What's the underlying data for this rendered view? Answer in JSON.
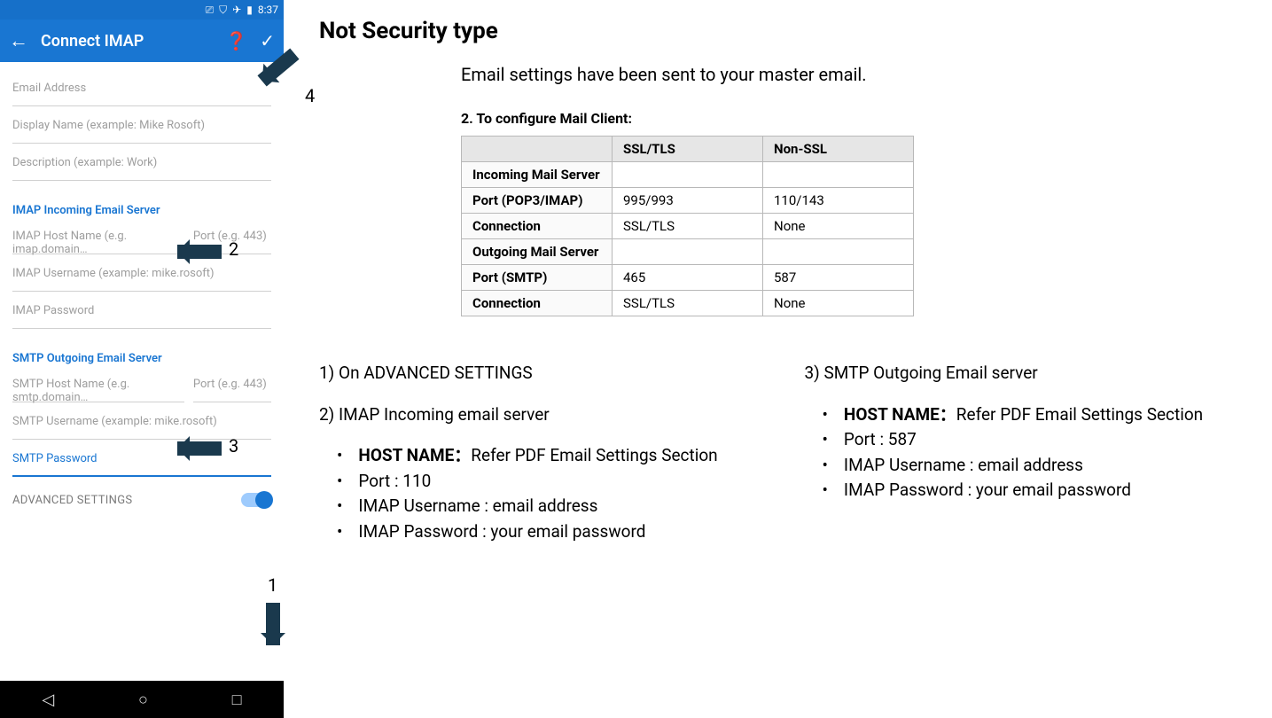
{
  "phone": {
    "status_time": "8:37",
    "icons": {
      "cast": "cast-icon",
      "wifi": "wifi-icon",
      "airplane": "airplane-icon",
      "battery": "battery-icon"
    },
    "appbar": {
      "title": "Connect IMAP"
    },
    "fields": {
      "email_ph": "Email Address",
      "display_ph": "Display Name (example: Mike Rosoft)",
      "desc_ph": "Description (example: Work)",
      "imap_section": "IMAP Incoming Email Server",
      "imap_host_ph": "IMAP Host Name (e.g. imap.domain…",
      "imap_port_ph": "Port (e.g. 443)",
      "imap_user_ph": "IMAP Username (example: mike.rosoft)",
      "imap_pw_ph": "IMAP Password",
      "smtp_section": "SMTP Outgoing Email Server",
      "smtp_host_ph": "SMTP Host Name (e.g. smtp.domain…",
      "smtp_port_ph": "Port (e.g. 443)",
      "smtp_user_ph": "SMTP Username (example: mike.rosoft)",
      "smtp_pw_ph": "SMTP Password",
      "advanced": "ADVANCED SETTINGS"
    }
  },
  "annot": {
    "n1": "1",
    "n2": "2",
    "n3": "3",
    "n4": "4"
  },
  "doc": {
    "title": "Not Security type",
    "sub": "Email settings have been sent to your master email.",
    "cfg_title": "2. To configure Mail Client:",
    "table_headers": {
      "blank": "",
      "ssl": "SSL/TLS",
      "nonssl": "Non-SSL"
    },
    "table_rows": [
      {
        "label": "Incoming Mail Server",
        "ssl": "",
        "nonssl": ""
      },
      {
        "label": "Port (POP3/IMAP)",
        "ssl": "995/993",
        "nonssl": "110/143"
      },
      {
        "label": "Connection",
        "ssl": "SSL/TLS",
        "nonssl": "None"
      },
      {
        "label": "Outgoing Mail Server",
        "ssl": "",
        "nonssl": ""
      },
      {
        "label": "Port (SMTP)",
        "ssl": "465",
        "nonssl": "587"
      },
      {
        "label": "Connection",
        "ssl": "SSL/TLS",
        "nonssl": "None"
      }
    ],
    "left": {
      "s1": "1) On ADVANCED SETTINGS",
      "s2": "2) IMAP Incoming email server",
      "b": [
        {
          "k": "HOST NAME：",
          "v": "Refer PDF Email Settings Section"
        },
        {
          "k": "Port : ",
          "v": "110"
        },
        {
          "k": "IMAP Username : ",
          "v": "email address"
        },
        {
          "k": "IMAP Password  :  ",
          "v": "your email password"
        }
      ]
    },
    "right": {
      "s3": "3) SMTP Outgoing Email server",
      "b": [
        {
          "k": "HOST NAME：",
          "v": "Refer PDF Email Settings Section"
        },
        {
          "k": "Port : ",
          "v": "587"
        },
        {
          "k": "IMAP Username : ",
          "v": "email address"
        },
        {
          "k": "IMAP Password  :  ",
          "v": "your email password"
        }
      ]
    }
  },
  "chart_data": {
    "type": "table",
    "title": "To configure Mail Client",
    "columns": [
      "",
      "SSL/TLS",
      "Non-SSL"
    ],
    "rows": [
      [
        "Incoming Mail Server",
        "",
        ""
      ],
      [
        "Port (POP3/IMAP)",
        "995/993",
        "110/143"
      ],
      [
        "Connection",
        "SSL/TLS",
        "None"
      ],
      [
        "Outgoing Mail Server",
        "",
        ""
      ],
      [
        "Port (SMTP)",
        "465",
        "587"
      ],
      [
        "Connection",
        "SSL/TLS",
        "None"
      ]
    ]
  }
}
